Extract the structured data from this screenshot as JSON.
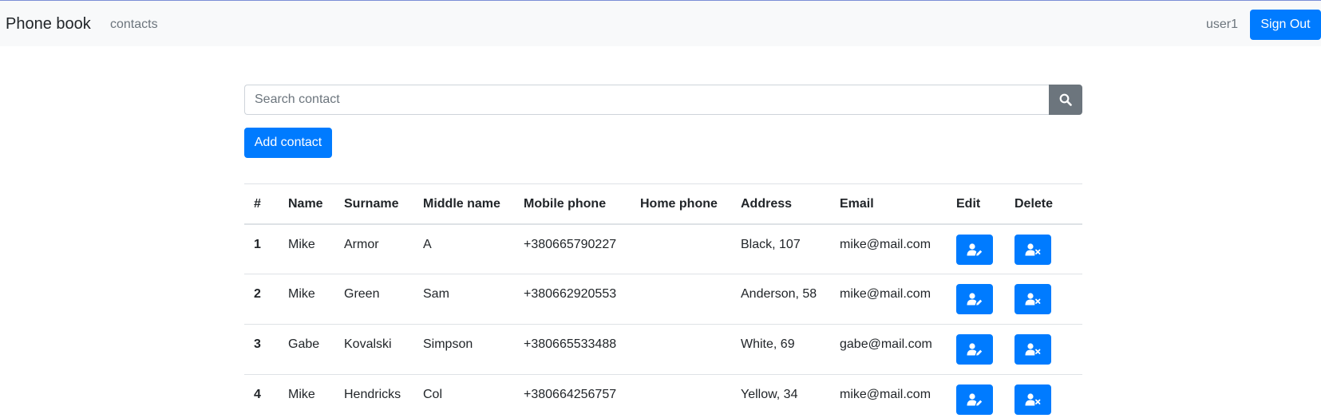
{
  "navbar": {
    "brand": "Phone book",
    "link": "contacts",
    "user": "user1",
    "signout_label": "Sign Out"
  },
  "search": {
    "placeholder": "Search contact",
    "value": ""
  },
  "add_label": "Add contact",
  "table": {
    "headers": [
      "#",
      "Name",
      "Surname",
      "Middle name",
      "Mobile phone",
      "Home phone",
      "Address",
      "Email",
      "Edit",
      "Delete"
    ],
    "rows": [
      {
        "num": "1",
        "name": "Mike",
        "surname": "Armor",
        "middle": "A",
        "mobile": "+380665790227",
        "home": "",
        "address": "Black, 107",
        "email": "mike@mail.com"
      },
      {
        "num": "2",
        "name": "Mike",
        "surname": "Green",
        "middle": "Sam",
        "mobile": "+380662920553",
        "home": "",
        "address": "Anderson, 58",
        "email": "mike@mail.com"
      },
      {
        "num": "3",
        "name": "Gabe",
        "surname": "Kovalski",
        "middle": "Simpson",
        "mobile": "+380665533488",
        "home": "",
        "address": "White, 69",
        "email": "gabe@mail.com"
      },
      {
        "num": "4",
        "name": "Mike",
        "surname": "Hendricks",
        "middle": "Col",
        "mobile": "+380664256757",
        "home": "",
        "address": "Yellow, 34",
        "email": "mike@mail.com"
      }
    ]
  },
  "icons": {
    "search": "search-icon",
    "edit": "user-edit-icon",
    "delete": "user-delete-icon"
  },
  "colors": {
    "primary": "#007bff",
    "secondary": "#6c757d",
    "navbar_bg": "#f8f9fa"
  }
}
